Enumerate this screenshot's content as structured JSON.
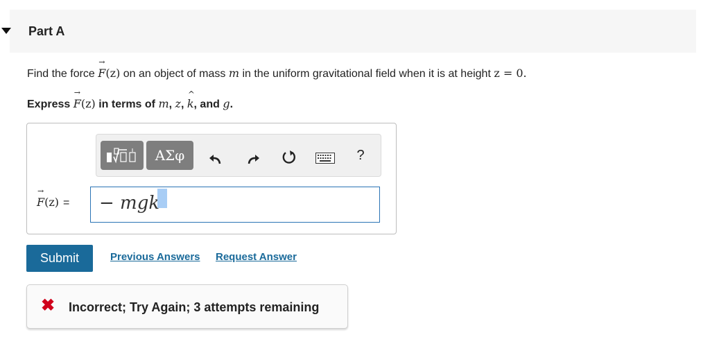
{
  "part": {
    "title": "Part A"
  },
  "question": {
    "prefix": "Find the force ",
    "f_symbol": "F",
    "f_arg": "(z)",
    "middle": " on an object of mass ",
    "mass": "m",
    "middle2": " in the uniform gravitational field when it is at height ",
    "condition": "z = 0."
  },
  "instruction": {
    "prefix": "Express ",
    "f_symbol": "F",
    "f_arg": "(z)",
    "middle": " in terms of ",
    "v1": "m",
    "sep1": ", ",
    "v2": "z",
    "sep2": ", ",
    "v3": "k",
    "sep3": ", and ",
    "v4": "g",
    "suffix": "."
  },
  "toolbar": {
    "template_icon": "templates-icon",
    "greek_label": "ΑΣφ",
    "undo_icon": "undo-icon",
    "redo_icon": "redo-icon",
    "reset_icon": "reset-icon",
    "keyboard_icon": "keyboard-icon",
    "help_label": "?"
  },
  "answer": {
    "label_symbol": "F",
    "label_arg": "(z)",
    "label_eq": "=",
    "value": "− mgk"
  },
  "actions": {
    "submit_label": "Submit",
    "previous_label": "Previous Answers",
    "request_label": "Request Answer"
  },
  "feedback": {
    "icon": "✖",
    "text": "Incorrect; Try Again; 3 attempts remaining"
  },
  "colors": {
    "accent": "#1a6a9a",
    "error": "#d0021b",
    "input_border": "#2a73b5"
  }
}
